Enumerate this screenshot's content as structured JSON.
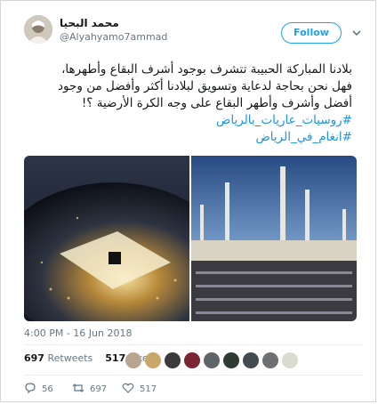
{
  "user": {
    "display_name": "محمد البحيا",
    "handle": "@Alyahyamo7ammad"
  },
  "follow_label": "Follow",
  "tweet": {
    "line1": "بلادنا المباركة الحبيبة تتشرف بوجود أشرف البقاع وأطهرها،",
    "line2": "فهل نحن بحاجة لدعاية وتسويق لبلادنا أكثر وأفضل من وجود",
    "line3": "أفضل وأشرف وأطهر البقاع على وجه الكرة الأرضية ؟!",
    "hashtag1": "#روسيات_عاريات_بالرياض",
    "hashtag2": "#انغام_في_الرياض"
  },
  "timestamp": "4:00 PM - 16 Jun 2018",
  "stats": {
    "retweets_count": "697",
    "retweets_label": "Retweets",
    "likes_count": "517",
    "likes_label": "Likes"
  },
  "actions": {
    "reply_count": "56",
    "retweet_count": "697",
    "like_count": "517"
  },
  "colors": {
    "accent": "#1da1f2",
    "hashtag": "#1b95e0",
    "muted": "#657786"
  },
  "icons": [
    "caret-down-icon",
    "reply-icon",
    "retweet-icon",
    "heart-icon"
  ]
}
